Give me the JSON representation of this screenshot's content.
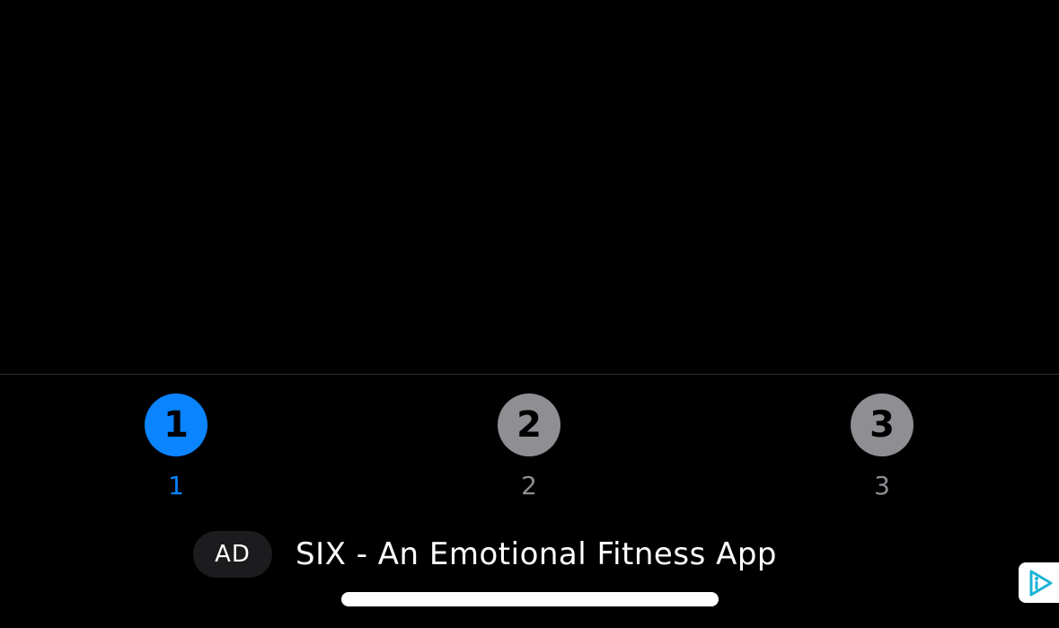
{
  "tabs": [
    {
      "icon_text": "1",
      "label": "1",
      "active": true
    },
    {
      "icon_text": "2",
      "label": "2",
      "active": false
    },
    {
      "icon_text": "3",
      "label": "3",
      "active": false
    }
  ],
  "ad": {
    "badge": "AD",
    "title": "SIX - An Emotional Fitness App",
    "choices_icon": "ad-choices-icon"
  },
  "colors": {
    "background": "#000000",
    "active": "#0a84ff",
    "inactive": "#8e8e93",
    "ad_badge_bg": "#1c1c1e",
    "ad_choices_accent": "#1bb3d6"
  }
}
